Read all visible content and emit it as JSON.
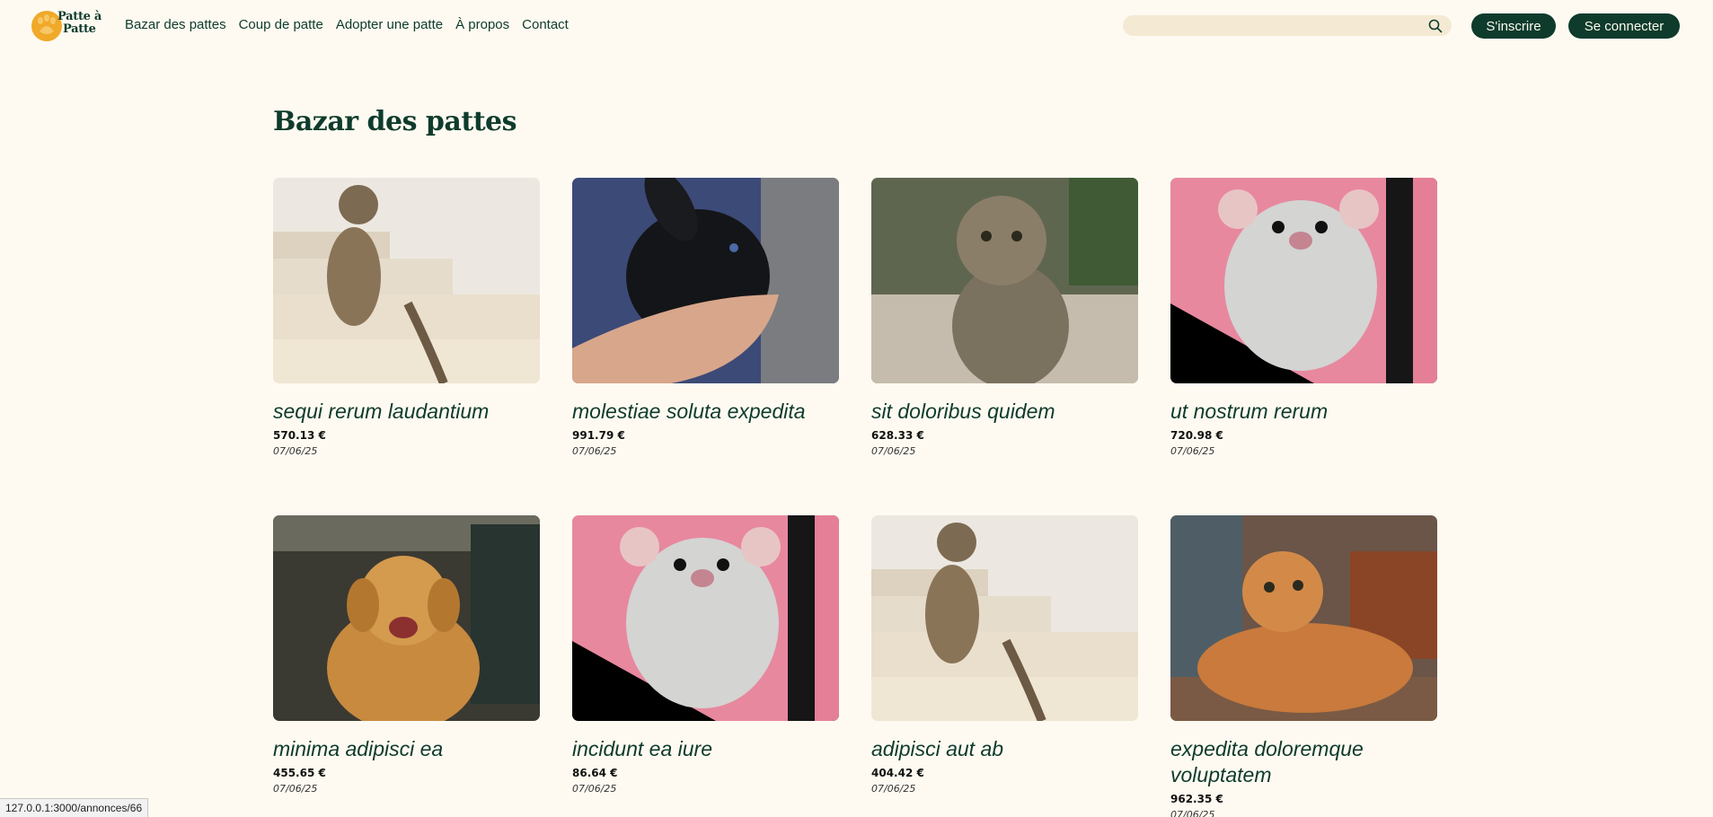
{
  "logo": {
    "line1": "Patte à",
    "line2": "Patte"
  },
  "nav": {
    "items": [
      {
        "label": "Bazar des pattes"
      },
      {
        "label": "Coup de patte"
      },
      {
        "label": "Adopter une patte"
      },
      {
        "label": "À propos"
      },
      {
        "label": "Contact"
      }
    ]
  },
  "search": {
    "placeholder": "",
    "value": "",
    "icon": "search-icon"
  },
  "auth": {
    "signup_label": "S'inscrire",
    "login_label": "Se connecter"
  },
  "page": {
    "title": "Bazar des pattes"
  },
  "listings": [
    {
      "title": "sequi rerum laudantium",
      "price": "570.13 €",
      "date": "07/06/25",
      "image": "tabby-cat-on-stairs"
    },
    {
      "title": "molestiae soluta expedita",
      "price": "991.79 €",
      "date": "07/06/25",
      "image": "black-rabbit-in-hand"
    },
    {
      "title": "sit doloribus quidem",
      "price": "628.33 €",
      "date": "07/06/25",
      "image": "tabby-kitten"
    },
    {
      "title": "ut nostrum rerum",
      "price": "720.98 €",
      "date": "07/06/25",
      "image": "white-rat-pink-background"
    },
    {
      "title": "minima adipisci ea",
      "price": "455.65 €",
      "date": "07/06/25",
      "image": "golden-retriever"
    },
    {
      "title": "incidunt ea iure",
      "price": "86.64 €",
      "date": "07/06/25",
      "image": "white-rat-pink-background"
    },
    {
      "title": "adipisci aut ab",
      "price": "404.42 €",
      "date": "07/06/25",
      "image": "tabby-cat-on-stairs"
    },
    {
      "title": "expedita doloremque voluptatem",
      "price": "962.35 €",
      "date": "07/06/25",
      "image": "orange-cat-lying"
    }
  ],
  "status_bar": {
    "url": "127.0.0.1:3000/annonces/66"
  },
  "colors": {
    "background": "#fefaf1",
    "primary": "#0e3b2c",
    "accent": "#f0a928",
    "search_bg": "#f4ead3"
  }
}
